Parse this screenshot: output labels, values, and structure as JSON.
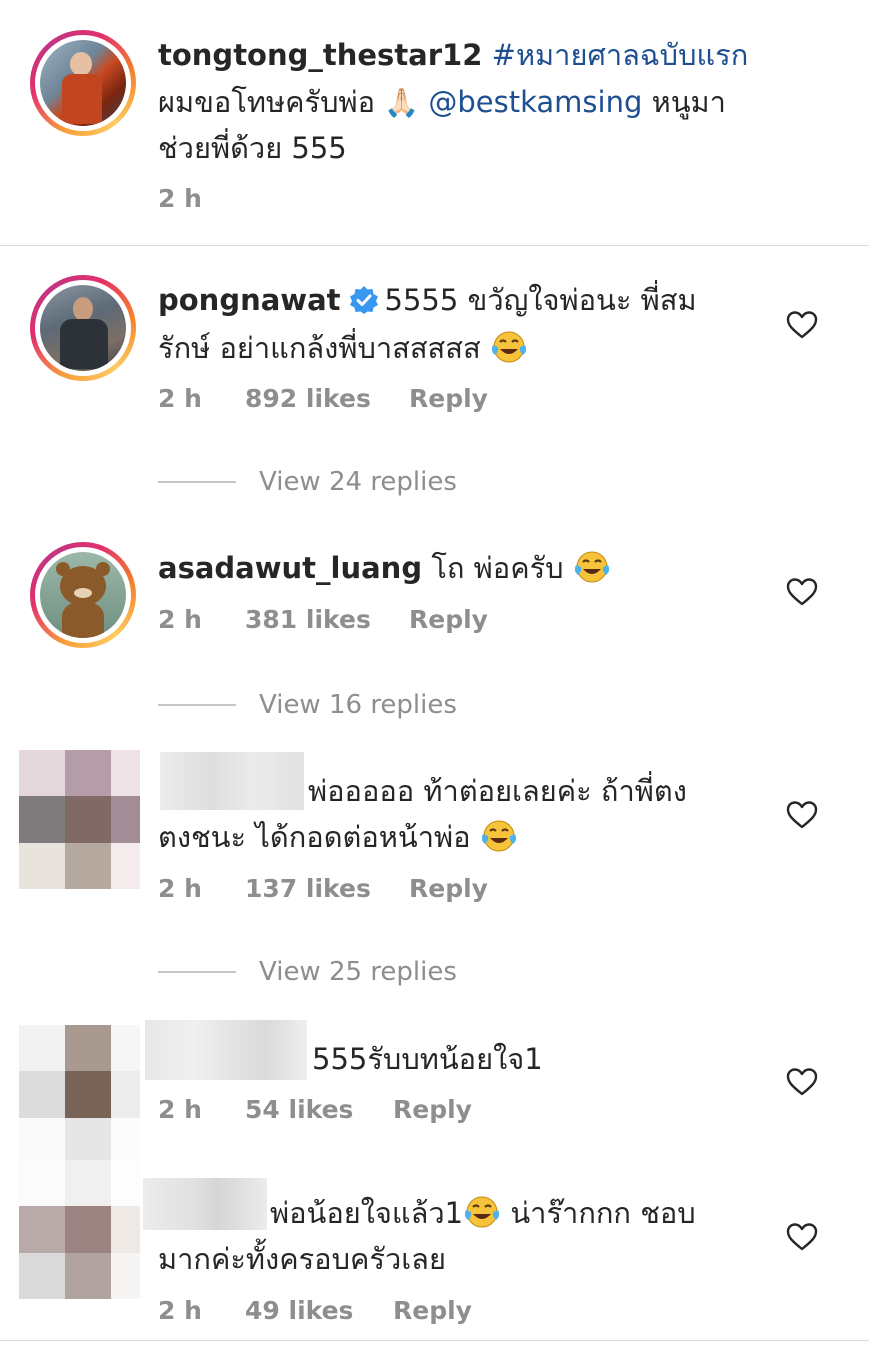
{
  "post": {
    "username": "tongtong_thestar12",
    "hashtag": "#หมายศาลฉบับแรก",
    "text_a": "ผมขอโทษครับพ่อ",
    "emoji_pray": "🙏🏻",
    "mention": "@bestkamsing",
    "text_b": "หนูมา",
    "text_c": "ช่วยพี่ด้วย 555",
    "time": "2 h"
  },
  "comments": [
    {
      "username": "pongnawat",
      "text_line1": "5555 ขวัญใจพ่อนะ พี่สม",
      "text_line2": "รักษ์ อย่าแกล้งพี่บาสสสสส",
      "time": "2 h",
      "likes": "892 likes",
      "reply": "Reply",
      "view_replies": "View 24 replies"
    },
    {
      "username": "asadawut_luang",
      "text_line1": "โถ พ่อครับ",
      "time": "2 h",
      "likes": "381 likes",
      "reply": "Reply",
      "view_replies": "View 16 replies"
    },
    {
      "text_line1": "พ่อออออ ท้าต่อยเลยค่ะ ถ้าพี่ตง",
      "text_line2": "ตงชนะ ได้กอดต่อหน้าพ่อ",
      "time": "2 h",
      "likes": "137 likes",
      "reply": "Reply",
      "view_replies": "View 25 replies"
    },
    {
      "text_line1": "555รับบทน้อยใจ1",
      "time": "2 h",
      "likes": "54 likes",
      "reply": "Reply"
    },
    {
      "text_line1": "พ่อน้อยใจแล้ว1",
      "text_line1b": "น่าร๊ากกก ชอบ",
      "text_line2": "มากค่ะทั้งครอบครัวเลย",
      "time": "2 h",
      "likes": "49 likes",
      "reply": "Reply"
    }
  ],
  "icons": {
    "like": "heart-outline-icon",
    "verified": "verified-badge-icon",
    "laugh": "face-with-tears-of-joy-emoji"
  },
  "colors": {
    "link": "#1d4f91",
    "meta": "#8e8e8e",
    "verified": "#3897f0"
  }
}
